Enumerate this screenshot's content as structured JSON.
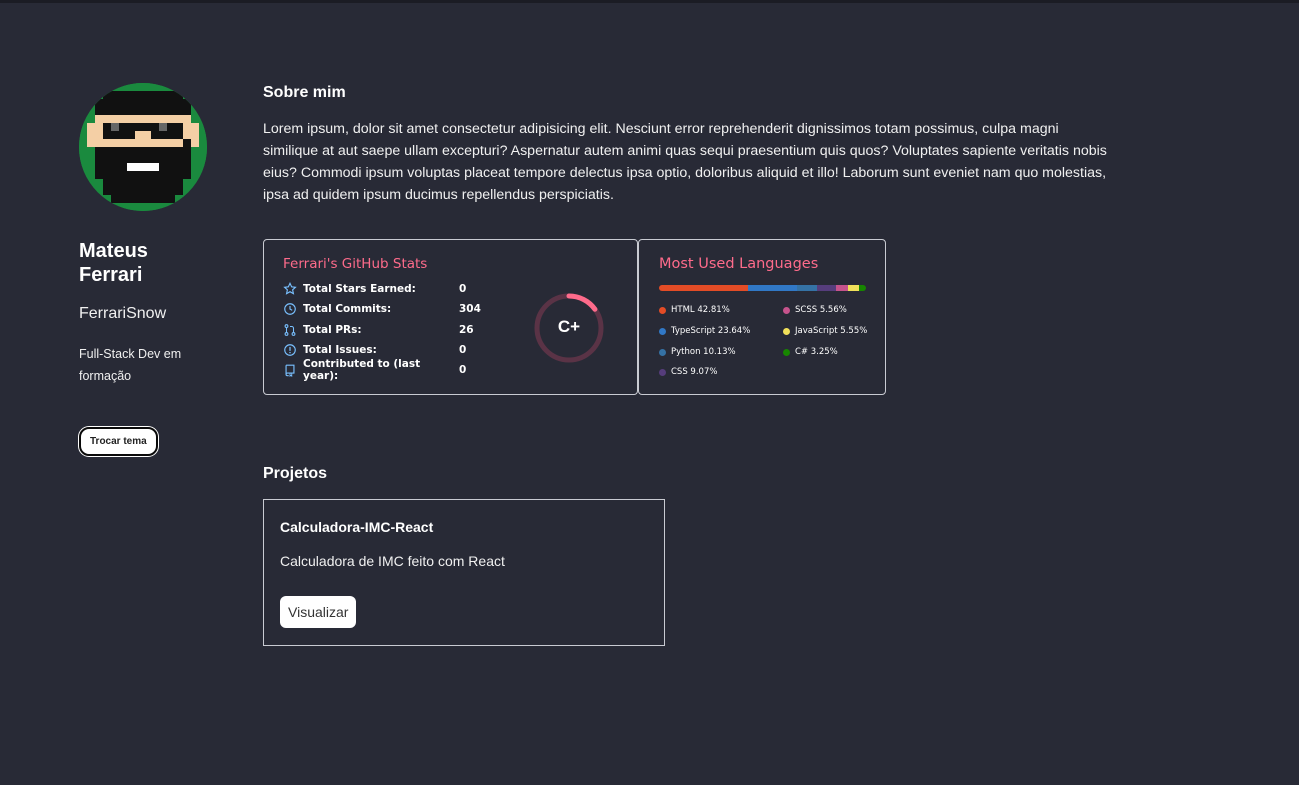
{
  "sidebar": {
    "name": "Mateus Ferrari",
    "username": "FerrariSnow",
    "bio": "Full-Stack Dev em formação",
    "theme_button": "Trocar tema"
  },
  "about": {
    "title": "Sobre mim",
    "text": "Lorem ipsum, dolor sit amet consectetur adipisicing elit. Nesciunt error reprehenderit dignissimos totam possimus, culpa magni similique at aut saepe ullam excepturi? Aspernatur autem animi quas sequi praesentium quis quos? Voluptates sapiente veritatis nobis eius? Commodi ipsum voluptas placeat tempore delectus ipsa optio, doloribus aliquid et illo! Laborum sunt eveniet nam quo molestias, ipsa ad quidem ipsum ducimus repellendus perspiciatis."
  },
  "stats": {
    "title": "Ferrari's GitHub Stats",
    "rows": [
      {
        "label": "Total Stars Earned:",
        "value": "0",
        "icon": "star-icon"
      },
      {
        "label": "Total Commits:",
        "value": "304",
        "icon": "history-icon"
      },
      {
        "label": "Total PRs:",
        "value": "26",
        "icon": "pull-request-icon"
      },
      {
        "label": "Total Issues:",
        "value": "0",
        "icon": "issue-icon"
      },
      {
        "label": "Contributed to (last year):",
        "value": "0",
        "icon": "repo-icon"
      }
    ],
    "rank": "C+",
    "rank_progress": 0.15
  },
  "languages": {
    "title": "Most Used Languages",
    "items": [
      {
        "label": "HTML 42.81%",
        "percent": 42.81,
        "color": "#e34c26"
      },
      {
        "label": "SCSS 5.56%",
        "percent": 5.56,
        "color": "#c6538c"
      },
      {
        "label": "TypeScript 23.64%",
        "percent": 23.64,
        "color": "#3178c6"
      },
      {
        "label": "JavaScript 5.55%",
        "percent": 5.55,
        "color": "#f1e05a"
      },
      {
        "label": "Python 10.13%",
        "percent": 10.13,
        "color": "#3572a5"
      },
      {
        "label": "C# 3.25%",
        "percent": 3.25,
        "color": "#178600"
      },
      {
        "label": "CSS 9.07%",
        "percent": 9.07,
        "color": "#563d7c"
      }
    ]
  },
  "projects": {
    "title": "Projetos",
    "items": [
      {
        "name": "Calculadora-IMC-React",
        "description": "Calculadora de IMC feito com React",
        "button": "Visualizar"
      }
    ]
  },
  "colors": {
    "background": "#282a36",
    "accent": "#fe6b8b",
    "icon": "#79ff97"
  }
}
